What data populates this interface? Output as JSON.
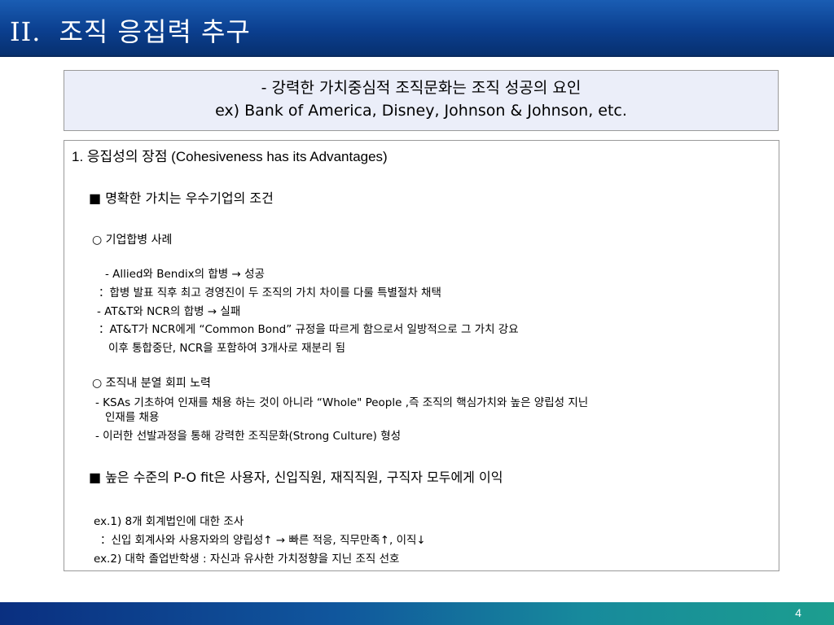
{
  "header": {
    "section_number": "II.",
    "title": "조직 응집력 추구"
  },
  "summary": {
    "line1": "- 강력한 가치중심적 조직문화는 조직 성공의 요인",
    "line2": "ex) Bank of America, Disney, Johnson & Johnson, etc."
  },
  "content": {
    "heading": "1. 응집성의 장점 (Cohesiveness has its Advantages)",
    "point1": {
      "title": "■ 명확한 가치는 우수기업의 조건",
      "sub1": {
        "title": "○ 기업합병 사례",
        "lines": [
          "- Allied와 Bendix의 합병 → 성공",
          "：합병 발표 직후 최고 경영진이 두 조직의 가치 차이를 다룰 특별절차 채택",
          "- AT&T와 NCR의 합병 → 실패",
          "：AT&T가 NCR에게 “Common Bond” 규정을 따르게 함으로서 일방적으로 그 가치 강요",
          "이후 통합중단,  NCR을 포함하여 3개사로 재분리 됨"
        ]
      },
      "sub2": {
        "title": "○ 조직내 분열 회피 노력",
        "lines": [
          "- KSAs 기초하여 인재를 채용 하는 것이 아니라 “Whole\" People ,즉 조직의 핵심가치와 높은 양립성 지닌",
          "인재를 채용",
          "- 이러한 선발과정을 통해 강력한 조직문화(Strong Culture) 형성"
        ]
      }
    },
    "point2": {
      "title": "■ 높은 수준의 P-O fit은 사용자, 신입직원, 재직직원, 구직자 모두에게 이익",
      "lines": [
        "ex.1) 8개 회계법인에 대한 조사",
        "：신입 회계사와 사용자와의 양립성↑ → 빠른 적응, 직무만족↑, 이직↓",
        "ex.2) 대학 졸업반학생 : 자신과 유사한 가치정향을 지닌 조직 선호"
      ]
    }
  },
  "footer": {
    "page_number": "4"
  }
}
